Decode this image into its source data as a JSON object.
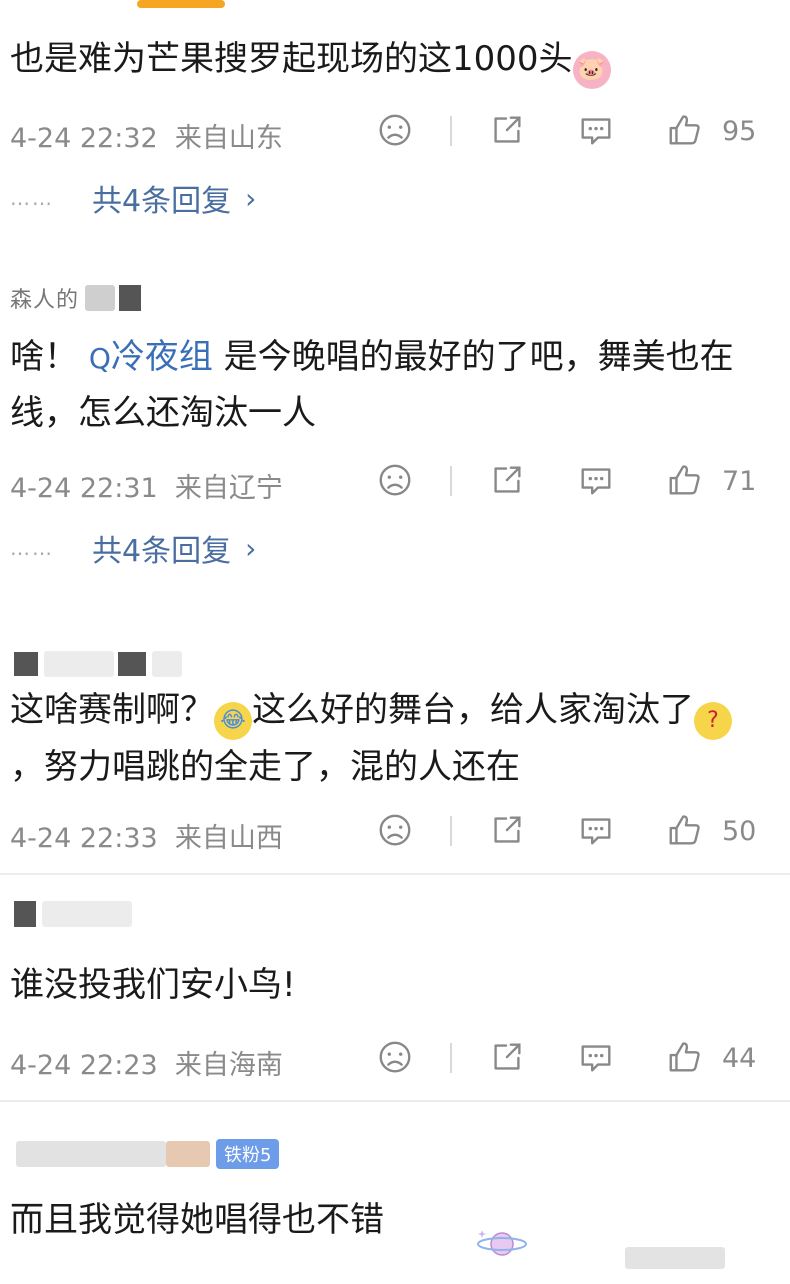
{
  "comments": [
    {
      "author": "",
      "text": "也是难为芒果搜罗起现场的这1000头",
      "emoji": "pig",
      "time": "4-24 22:32",
      "location": "来自山东",
      "likes": "95",
      "replies": "共4条回复"
    },
    {
      "author": "森人的",
      "text_before": "啥！",
      "mention": "冷夜组",
      "text_after": "是今晚唱的最好的了吧，舞美也在线，怎么还淘汰一人",
      "time": "4-24 22:31",
      "location": "来自辽宁",
      "likes": "71",
      "replies": "共4条回复"
    },
    {
      "author": "",
      "text_a": "这啥赛制啊？",
      "emoji_a": "cry-laugh",
      "text_b": "这么好的舞台，给人家淘汰了",
      "emoji_b": "think",
      "text_c": "，努力唱跳的全走了，混的人还在",
      "time": "4-24 22:33",
      "location": "来自山西",
      "likes": "50"
    },
    {
      "author": "",
      "text": "谁没投我们安小鸟!",
      "time": "4-24 22:23",
      "location": "来自海南",
      "likes": "44"
    },
    {
      "author": "",
      "badge": "铁粉5",
      "text": "而且我觉得她唱得也不错"
    }
  ],
  "icons": [
    "sad-face-icon",
    "share-icon",
    "comment-icon",
    "like-icon",
    "chevron-right-icon"
  ],
  "colors": {
    "accent": "#f5a623",
    "link": "#4a6ea0",
    "mention": "#3a6fb8",
    "meta": "#8a8a8a",
    "badge": "#6d9ce8"
  }
}
